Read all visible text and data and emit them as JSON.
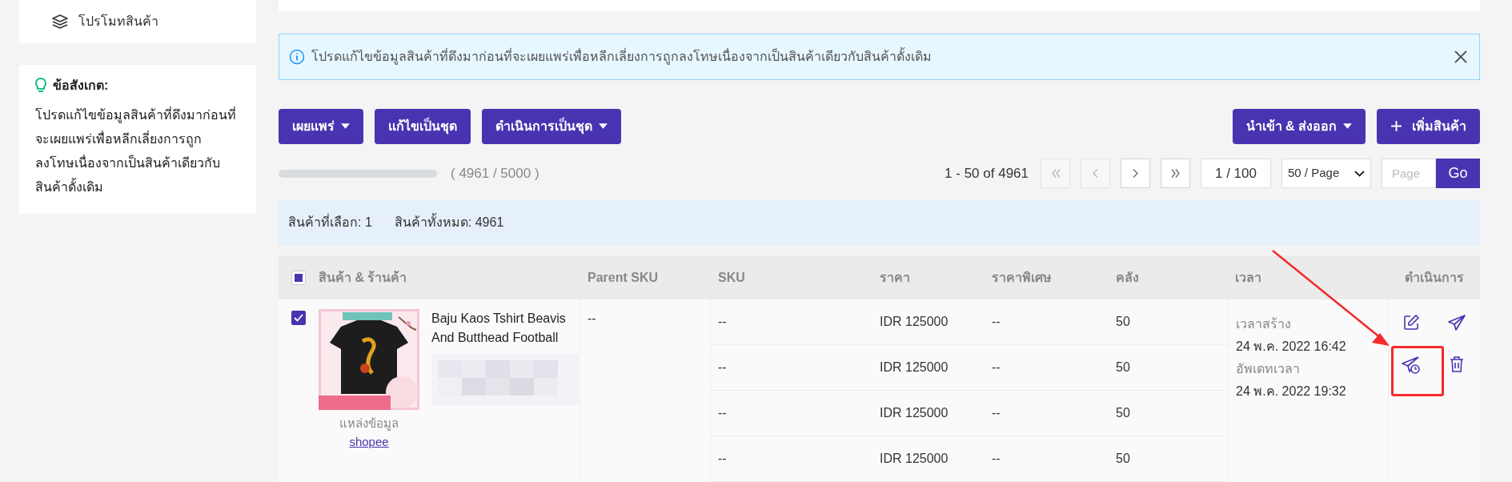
{
  "sidebar": {
    "menu_item": {
      "label": "โปรโมทสินค้า"
    },
    "note": {
      "title": "ข้อสังเกต:",
      "text": "โปรดแก้ไขข้อมูลสินค้าที่ดึงมาก่อนที่จะเผยแพร่เพื่อหลีกเลี่ยงการถูกลงโทษเนื่องจากเป็นสินค้าเดียวกับสินค้าดั้งเดิม"
    }
  },
  "alert": {
    "text": "โปรดแก้ไขข้อมูลสินค้าที่ดึงมาก่อนที่จะเผยแพร่เพื่อหลีกเลี่ยงการถูกลงโทษเนื่องจากเป็นสินค้าเดียวกับสินค้าดั้งเดิม"
  },
  "toolbar": {
    "left": [
      {
        "label": "เผยแพร่",
        "kind": "dropdown"
      },
      {
        "label": "แก้ไขเป็นชุด",
        "kind": "plain"
      },
      {
        "label": "ดำเนินการเป็นชุด",
        "kind": "dropdown"
      }
    ],
    "right": [
      {
        "label": "นำเข้า & ส่งออก",
        "kind": "dropdown"
      },
      {
        "label": "เพิ่มสินค้า",
        "kind": "add"
      }
    ]
  },
  "quota": {
    "level": 0.99,
    "text": "( 4961 / 5000 )"
  },
  "pagination": {
    "range": "1 - 50 of 4961",
    "nav": [
      {
        "kind": "first",
        "disabled": true
      },
      {
        "kind": "prev",
        "disabled": true
      },
      {
        "kind": "next",
        "disabled": false
      },
      {
        "kind": "last",
        "disabled": false
      }
    ],
    "page": "1 / 100",
    "page_size": "50 / Page",
    "jump_placeholder": "Page",
    "go": "Go"
  },
  "selection": {
    "selected": "สินค้าที่เลือก: 1",
    "total": "สินค้าทั้งหมด: 4961"
  },
  "table": {
    "indeterminate": true,
    "columns": [
      "สินค้า & ร้านค้า",
      "Parent SKU",
      "SKU",
      "ราคา",
      "ราคาพิเศษ",
      "คลัง",
      "เวลา",
      "ดำเนินการ"
    ],
    "rows": [
      {
        "checked": true,
        "name": "Baju Kaos Tshirt Beavis And Butthead Football",
        "source_label": "แหล่งข้อมูล",
        "source_link": "shopee",
        "parent_sku": "--",
        "variants": [
          {
            "sku": "--",
            "price": "IDR 125000",
            "special_price": "--",
            "stock": "50"
          },
          {
            "sku": "--",
            "price": "IDR 125000",
            "special_price": "--",
            "stock": "50"
          },
          {
            "sku": "--",
            "price": "IDR 125000",
            "special_price": "--",
            "stock": "50"
          },
          {
            "sku": "--",
            "price": "IDR 125000",
            "special_price": "--",
            "stock": "50"
          }
        ],
        "created_label": "เวลาสร้าง",
        "created": "24 พ.ค. 2022 16:42",
        "updated_label": "อัพเดทเวลา",
        "updated": "24 พ.ค. 2022 19:32"
      }
    ]
  }
}
